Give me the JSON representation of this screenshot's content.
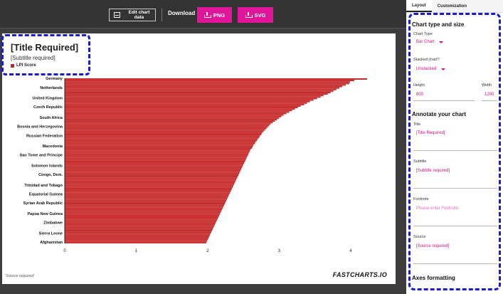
{
  "toolbar": {
    "edit_label": "Edit chart data",
    "download_label": "Download",
    "png_label": "PNG",
    "svg_label": "SVG"
  },
  "chart": {
    "title": "[Title Required]",
    "subtitle": "[Subtitle required]",
    "legend_label": "LPI Score",
    "source": "'Source required'",
    "brand": "FASTCHARTS.IO"
  },
  "chart_data": {
    "type": "bar",
    "orientation": "horizontal",
    "series": [
      {
        "name": "LPI Score",
        "color": "#c62828"
      }
    ],
    "xlim": [
      0,
      4.2
    ],
    "x_ticks": [
      "0",
      "1",
      "2",
      "3",
      "4"
    ],
    "grid": false,
    "categories": [
      "Germany",
      "Netherlands",
      "United Kingdom",
      "Czech Republic",
      "South Africa",
      "Bosnia and Herzegovina",
      "Russian Federation",
      "Macedonia",
      "Sao Tome and Principe",
      "Solomon Islands",
      "Congo, Dem.",
      "Trinidad and Tobago",
      "Equatorial Guinea",
      "Syrian Arab Republic",
      "Papua New Guinea",
      "Zimbabwe",
      "Sierra Leone",
      "Afghanistan"
    ],
    "values_sorted_desc": [
      4.23,
      4.05,
      3.99,
      3.98,
      3.93,
      3.88,
      3.84,
      3.8,
      3.76,
      3.72,
      3.68,
      3.62,
      3.58,
      3.53,
      3.48,
      3.43,
      3.39,
      3.35,
      3.3,
      3.26,
      3.22,
      3.18,
      3.14,
      3.1,
      3.06,
      3.03,
      3.0,
      2.97,
      2.94,
      2.91,
      2.88,
      2.86,
      2.84,
      2.82,
      2.8,
      2.78,
      2.76,
      2.75,
      2.73,
      2.72,
      2.7,
      2.69,
      2.67,
      2.66,
      2.64,
      2.63,
      2.62,
      2.6,
      2.59,
      2.58,
      2.57,
      2.56,
      2.55,
      2.54,
      2.53,
      2.52,
      2.51,
      2.5,
      2.49,
      2.48,
      2.47,
      2.46,
      2.45,
      2.44,
      2.43,
      2.42,
      2.41,
      2.4,
      2.39,
      2.38,
      2.37,
      2.36,
      2.35,
      2.34,
      2.33,
      2.32,
      2.31,
      2.3,
      2.29,
      2.28,
      2.27,
      2.26,
      2.25,
      2.24,
      2.23,
      2.22,
      2.21,
      2.2,
      2.19,
      2.18,
      2.17,
      2.16,
      2.15,
      2.14,
      2.13,
      2.12,
      2.11,
      2.1,
      2.09,
      2.08,
      2.07,
      2.06,
      2.05,
      2.04,
      2.03,
      2.02,
      2.01,
      2.0,
      1.99,
      1.98
    ]
  },
  "panel": {
    "tabs": [
      {
        "label": "Layout",
        "active": true
      },
      {
        "label": "Customization",
        "active": false
      }
    ],
    "section_type": "Chart type and size",
    "chart_type_label": "Chart Type",
    "chart_type_value": "Bar Chart",
    "stacked_label": "Stacked chart?",
    "stacked_value": "Unstacked",
    "height_label": "Height",
    "height_value": "800",
    "width_label": "Width",
    "width_value": "1200",
    "section_annotate": "Annotate your chart",
    "title_label": "Title",
    "title_value": "[Title Required]",
    "subtitle_label": "Subtitle",
    "subtitle_value": "[Subtitle required]",
    "footnote_label": "Footnote",
    "footnote_placeholder": "Please enter Footnote",
    "source_label": "Source",
    "source_value": "[Source required]",
    "section_axes": "Axes formatting"
  }
}
